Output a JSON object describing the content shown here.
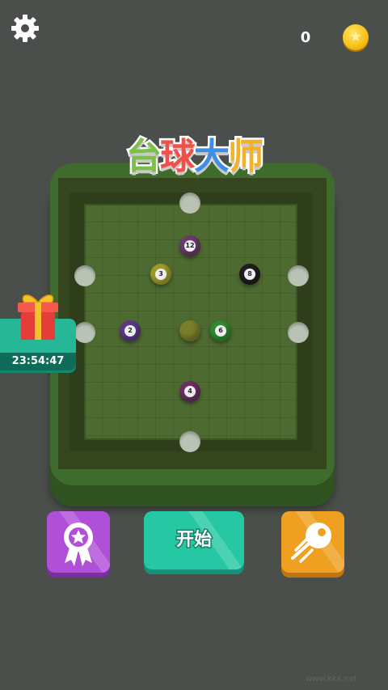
{
  "top_bar": {
    "settings_icon": "gear-icon",
    "coins": "0",
    "coin_icon": "coin-star-icon"
  },
  "title": {
    "chars": [
      "台",
      "球",
      "大",
      "师"
    ],
    "colors": [
      "#7cc04a",
      "#f0504a",
      "#3c8fe6",
      "#f2b12a"
    ]
  },
  "table": {
    "felt_color": "#4d6a30",
    "rail_color": "#3f6b2d",
    "balls": [
      {
        "label": "12",
        "color": "#6a3a6a"
      },
      {
        "label": "3",
        "color": "#9a9a2c"
      },
      {
        "label": "8",
        "color": "#1e1e1e"
      },
      {
        "label": "2",
        "color": "#5a3a86"
      },
      {
        "label": "",
        "color": "#7a7d2a"
      },
      {
        "label": "6",
        "color": "#2f8a2f"
      },
      {
        "label": "4",
        "color": "#6a3060"
      }
    ]
  },
  "gift": {
    "icon": "gift-icon",
    "timer": "23:54:47"
  },
  "buttons": {
    "rank_icon": "award-ribbon-icon",
    "start_label": "开始",
    "ball_icon": "ball-speed-icon"
  },
  "watermark": "www.kkx.net",
  "colors": {
    "background": "#4b4f4b",
    "rank_button": "#b04fd8",
    "start_button": "#26c7a3",
    "ball_button": "#f0a020"
  }
}
